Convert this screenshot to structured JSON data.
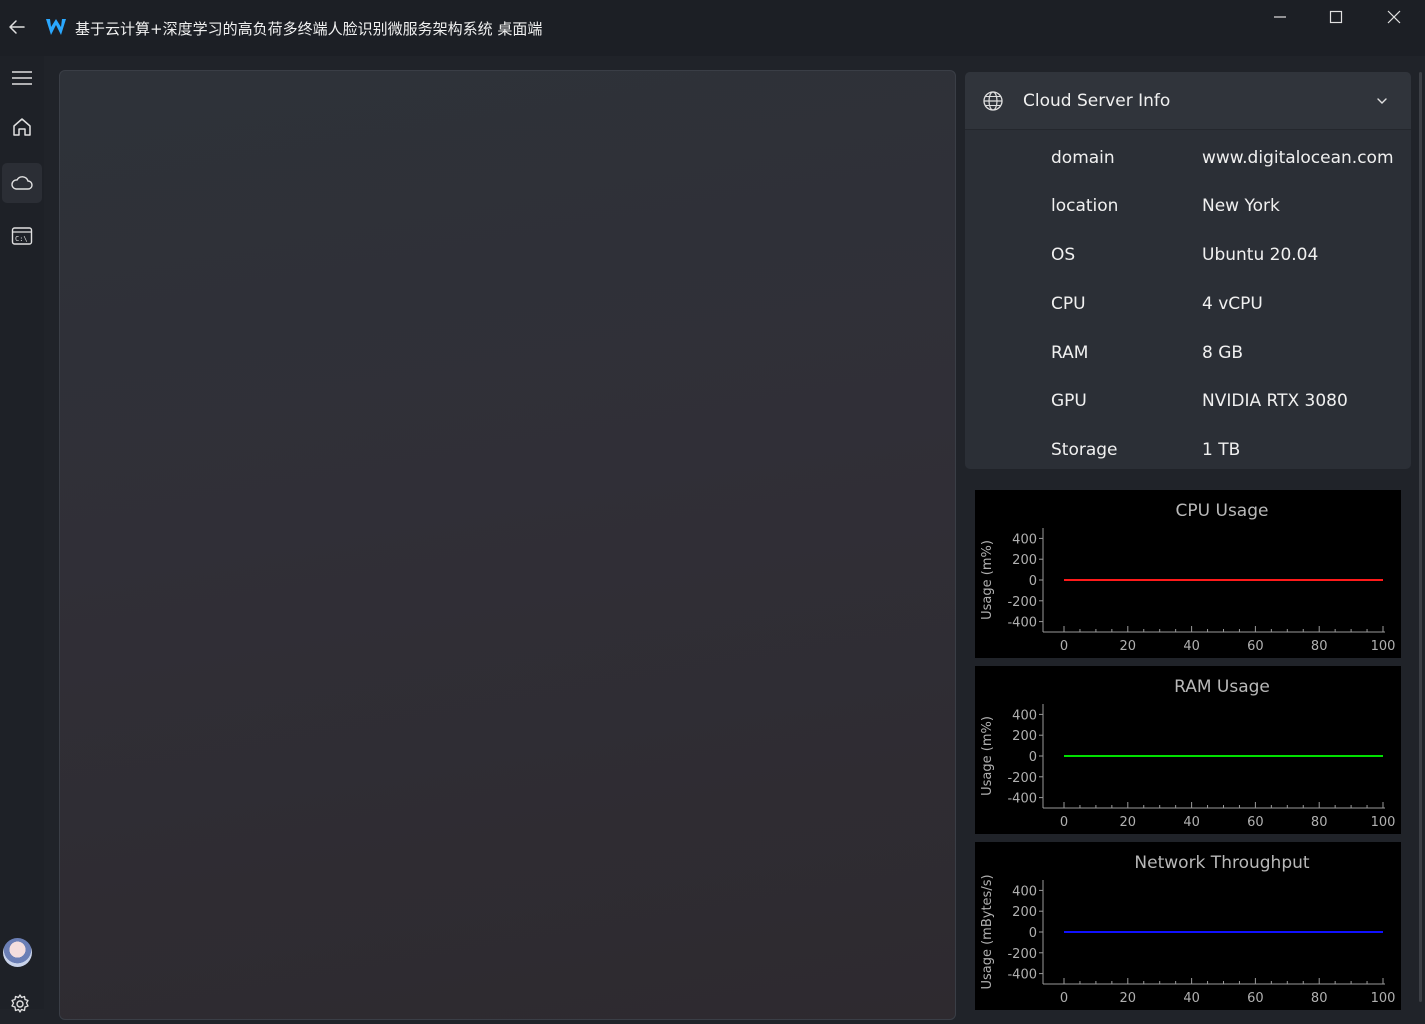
{
  "window": {
    "title": "基于云计算+深度学习的高负荷多终端人脸识别微服务架构系统 桌面端"
  },
  "sidebar": {
    "items": [
      {
        "name": "menu",
        "icon": "hamburger-icon"
      },
      {
        "name": "home",
        "icon": "home-icon"
      },
      {
        "name": "cloud",
        "icon": "cloud-icon",
        "active": true
      },
      {
        "name": "terminal",
        "icon": "terminal-icon"
      }
    ],
    "bottom": [
      {
        "name": "avatar",
        "icon": "avatar"
      },
      {
        "name": "settings",
        "icon": "gear-icon"
      }
    ]
  },
  "info_card": {
    "title": "Cloud Server Info",
    "rows": [
      {
        "key": "domain",
        "value": "www.digitalocean.com"
      },
      {
        "key": "location",
        "value": "New York"
      },
      {
        "key": "OS",
        "value": "Ubuntu 20.04"
      },
      {
        "key": "CPU",
        "value": "4 vCPU"
      },
      {
        "key": "RAM",
        "value": "8 GB"
      },
      {
        "key": "GPU",
        "value": "NVIDIA RTX 3080"
      },
      {
        "key": "Storage",
        "value": "1 TB"
      }
    ]
  },
  "colors": {
    "cpu": "#ff1a1a",
    "ram": "#00e000",
    "network": "#1010ff"
  },
  "chart_data": [
    {
      "type": "line",
      "title": "CPU Usage",
      "ylabel": "Usage (m%)",
      "xlabel": "",
      "xlim": [
        0,
        100
      ],
      "ylim": [
        -500,
        500
      ],
      "xticks": [
        0,
        20,
        40,
        60,
        80,
        100
      ],
      "yticks": [
        400,
        200,
        0,
        -200,
        -400
      ],
      "series": [
        {
          "x": [
            0,
            100
          ],
          "values": [
            0,
            0
          ],
          "color": "#ff1a1a"
        }
      ],
      "grid": false
    },
    {
      "type": "line",
      "title": "RAM Usage",
      "ylabel": "Usage (m%)",
      "xlabel": "",
      "xlim": [
        0,
        100
      ],
      "ylim": [
        -500,
        500
      ],
      "xticks": [
        0,
        20,
        40,
        60,
        80,
        100
      ],
      "yticks": [
        400,
        200,
        0,
        -200,
        -400
      ],
      "series": [
        {
          "x": [
            0,
            100
          ],
          "values": [
            0,
            0
          ],
          "color": "#00e000"
        }
      ],
      "grid": false
    },
    {
      "type": "line",
      "title": "Network Throughput",
      "ylabel": "Usage (mBytes/s)",
      "xlabel": "",
      "xlim": [
        0,
        100
      ],
      "ylim": [
        -500,
        500
      ],
      "xticks": [
        0,
        20,
        40,
        60,
        80,
        100
      ],
      "yticks": [
        400,
        200,
        0,
        -200,
        -400
      ],
      "series": [
        {
          "x": [
            0,
            100
          ],
          "values": [
            0,
            0
          ],
          "color": "#1010ff"
        }
      ],
      "grid": false
    }
  ]
}
